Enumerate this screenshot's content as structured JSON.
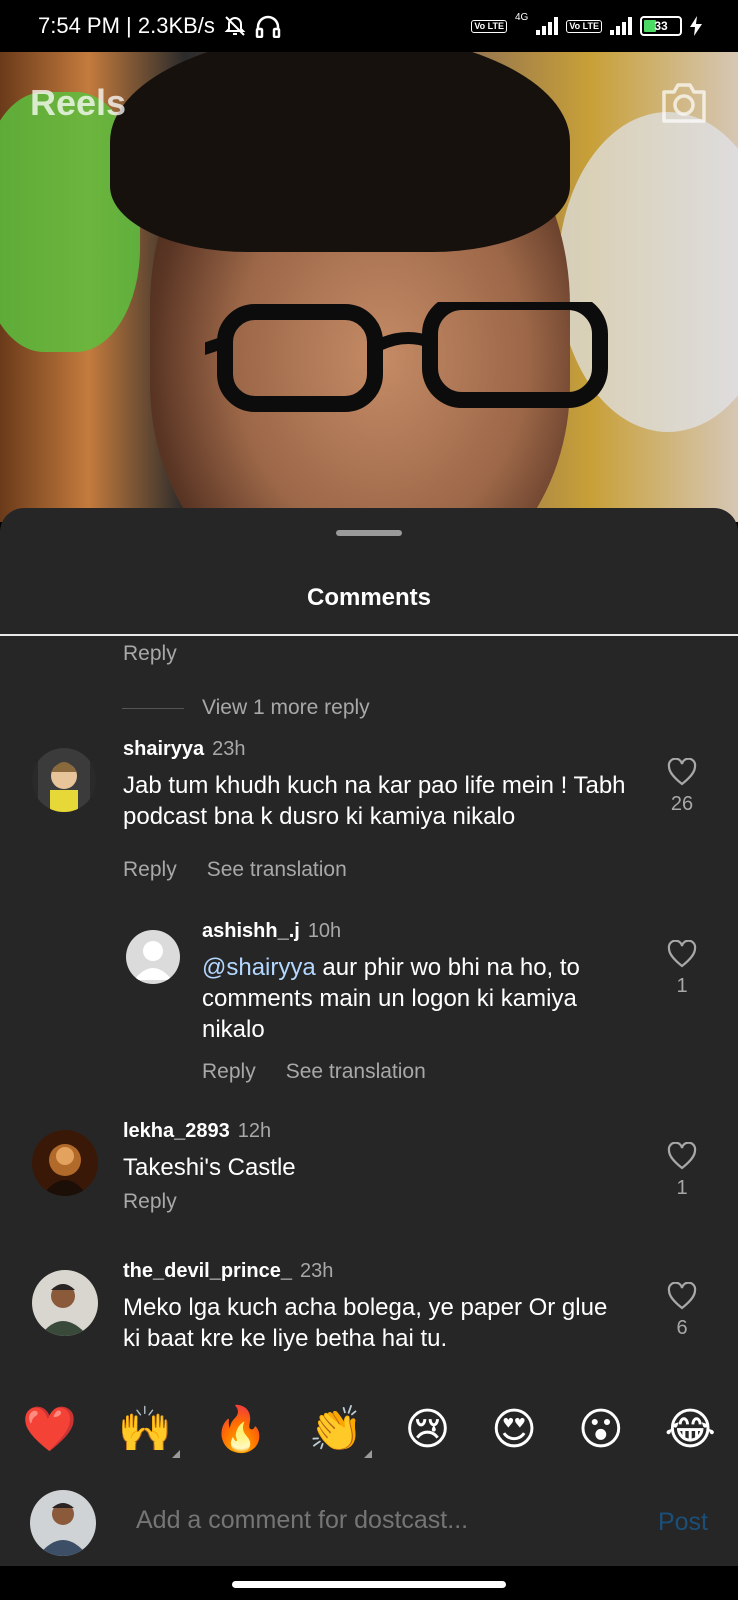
{
  "status_bar": {
    "time_speed": "7:54 PM | 2.3KB/s",
    "network_label": "4G",
    "lte_label": "Vo LTE",
    "battery": "33"
  },
  "video": {
    "title": "Reels"
  },
  "comments_sheet": {
    "title": "Comments",
    "top_reply_label": "Reply",
    "view_more_label": "View 1 more reply",
    "comments": [
      {
        "username": "shairyya",
        "time": "23h",
        "text": "Jab tum khudh kuch na kar pao life mein ! Tabh podcast bna k dusro ki kamiya nikalo",
        "likes": "26",
        "reply_label": "Reply",
        "translate_label": "See translation"
      },
      {
        "username": "ashishh_.j",
        "time": "10h",
        "mention": "@shairyya",
        "text": " aur phir wo bhi na ho, to comments main un logon ki kamiya nikalo",
        "likes": "1",
        "reply_label": "Reply",
        "translate_label": "See translation"
      },
      {
        "username": "lekha_2893",
        "time": "12h",
        "text": "Takeshi's Castle",
        "likes": "1",
        "reply_label": "Reply"
      },
      {
        "username": "the_devil_prince_",
        "time": "23h",
        "text": "Meko lga kuch acha bolega, ye paper Or glue ki baat kre ke liye betha hai tu.",
        "likes": "6"
      }
    ]
  },
  "emoji_bar": {
    "emojis": [
      "❤️",
      "🙌",
      "🔥",
      "👏",
      "😢",
      "😍",
      "😮",
      "😂"
    ]
  },
  "input": {
    "placeholder": "Add a comment for dostcast...",
    "post_label": "Post"
  }
}
